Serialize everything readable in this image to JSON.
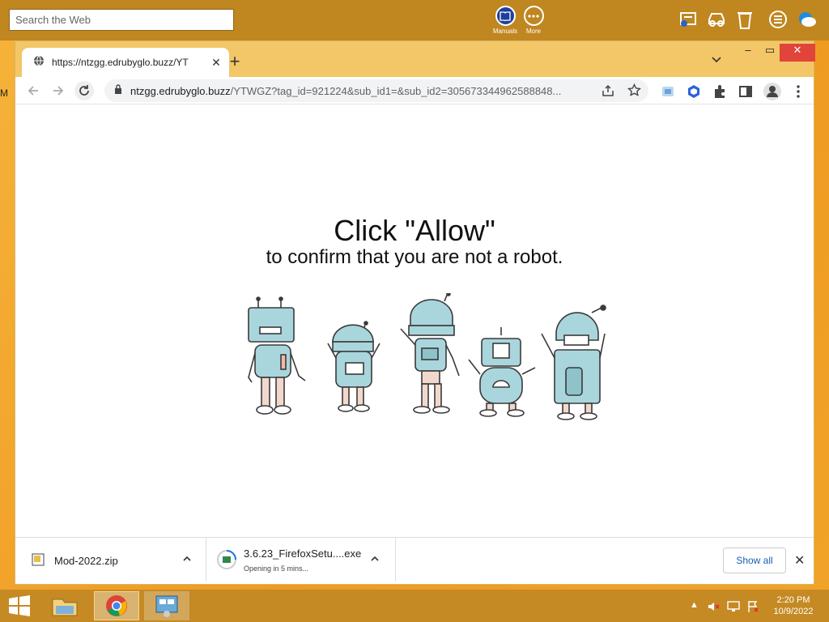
{
  "desktop": {
    "edge_label": "M"
  },
  "topbar": {
    "search_placeholder": "Search the Web",
    "manuals_label": "Manuals",
    "more_label": "More"
  },
  "browser": {
    "tab_title": "https://ntzgg.edrubyglo.buzz/YT",
    "url_host": "ntzgg.edrubyglo.buzz",
    "url_path": "/YTWGZ?tag_id=921224&sub_id1=&sub_id2=305673344962588848..."
  },
  "page": {
    "headline": "Click \"Allow\"",
    "subline": "to confirm that you are not a robot."
  },
  "downloads": {
    "items": [
      {
        "name": "Mod-2022.zip",
        "status": ""
      },
      {
        "name": "3.6.23_FirefoxSetu....exe",
        "status": "Opening in 5 mins..."
      }
    ],
    "show_all_label": "Show all"
  },
  "taskbar": {
    "time": "2:20 PM",
    "date": "10/9/2022"
  },
  "colors": {
    "desktop_orange": "#f2a22a",
    "titlebar": "#f3c667",
    "taskbar": "#c58a24",
    "robot_blue": "#a9d6dc"
  }
}
